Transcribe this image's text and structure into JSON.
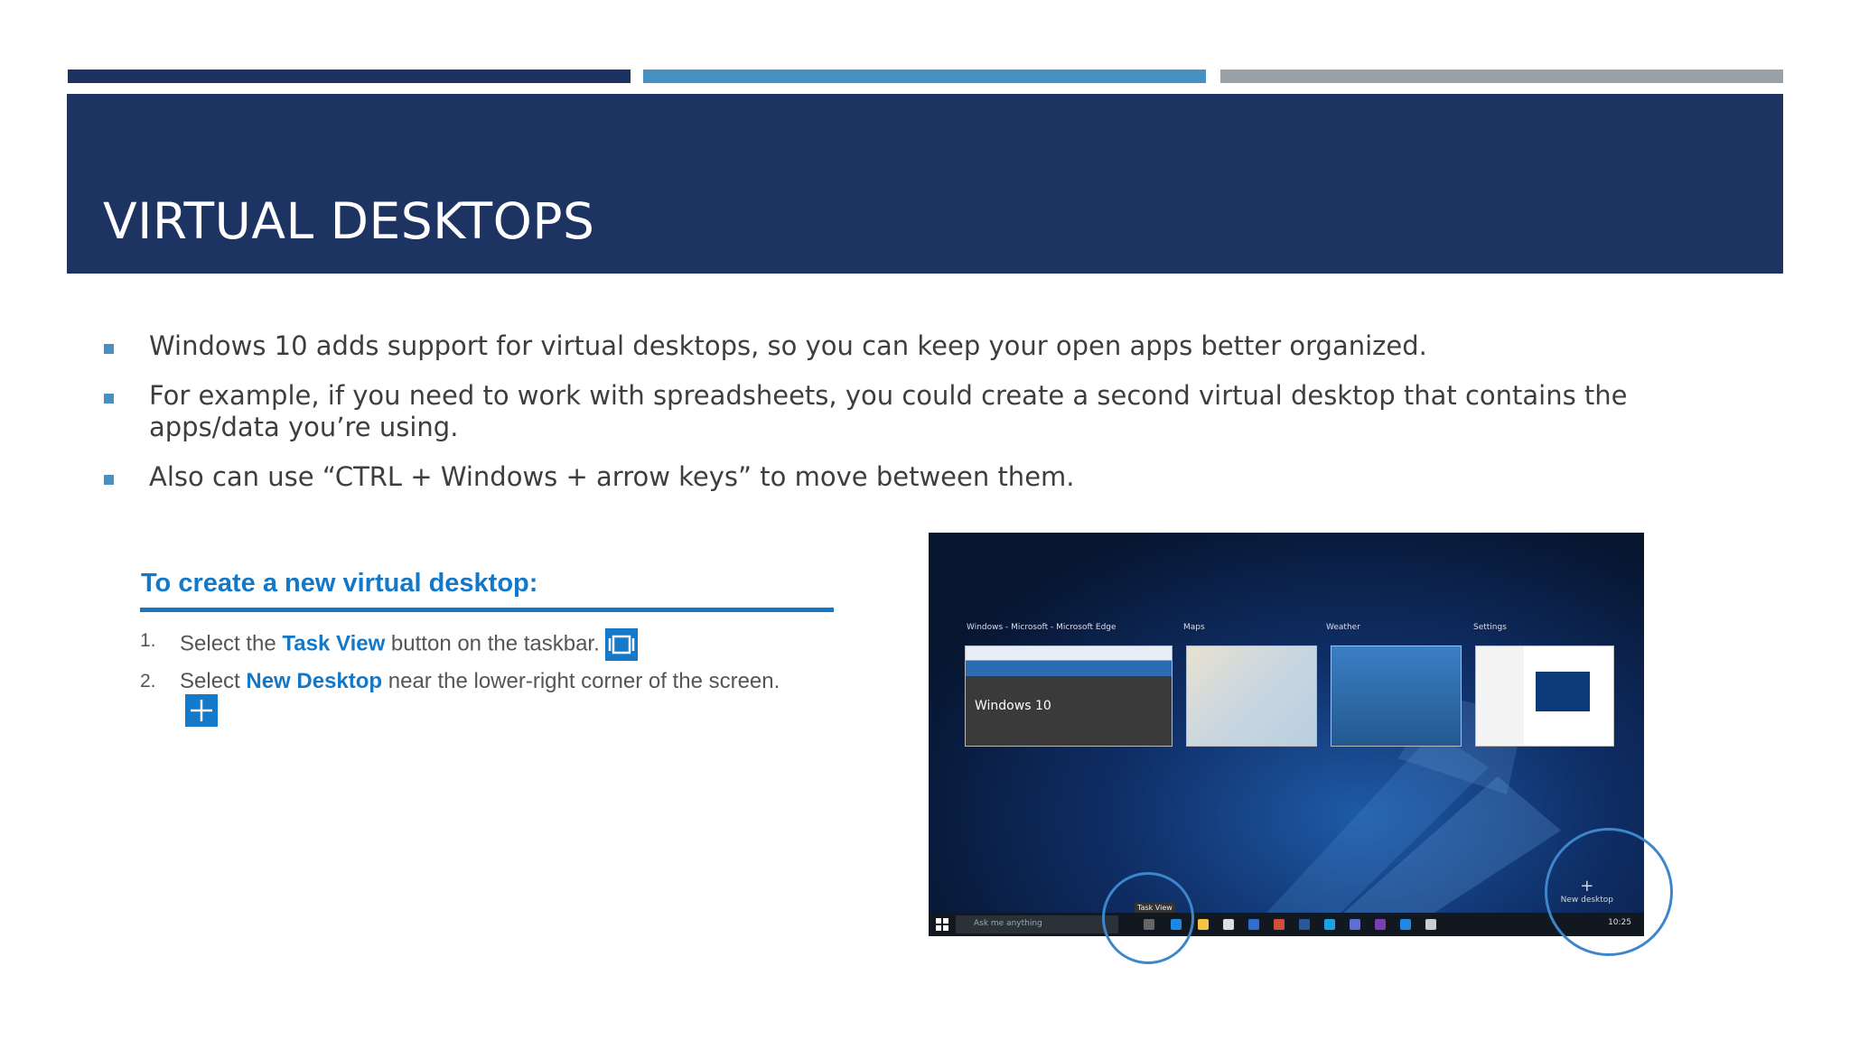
{
  "slide": {
    "title": "VIRTUAL DESKTOPS",
    "accent_colors": [
      "#1c3361",
      "#4690c4",
      "#9aa1a6"
    ],
    "bullets": [
      "Windows 10 adds support for virtual desktops, so you can keep your open apps better organized.",
      "For example, if you need to work with spreadsheets, you could create a second virtual desktop that contains the apps/data you’re using.",
      "Also can use “CTRL + Windows + arrow keys” to move between them."
    ]
  },
  "howto": {
    "heading": "To create a new virtual desktop:",
    "step1": {
      "num": "1.",
      "pre": "Select the ",
      "keyword": "Task View",
      "post": " button on the taskbar.",
      "icon": "task-view-icon"
    },
    "step2": {
      "num": "2.",
      "pre": "Select ",
      "keyword": "New Desktop",
      "post": " near the lower-right corner of the screen.",
      "icon": "plus-icon"
    }
  },
  "screenshot": {
    "thumb_titles": [
      "Windows - Microsoft - Microsoft Edge",
      "Maps",
      "Weather",
      "Settings"
    ],
    "thumb_caption": "Windows 10",
    "search_placeholder": "Ask me anything",
    "tooltip": "Task View",
    "new_desktop": "New desktop",
    "clock": "10:25"
  }
}
